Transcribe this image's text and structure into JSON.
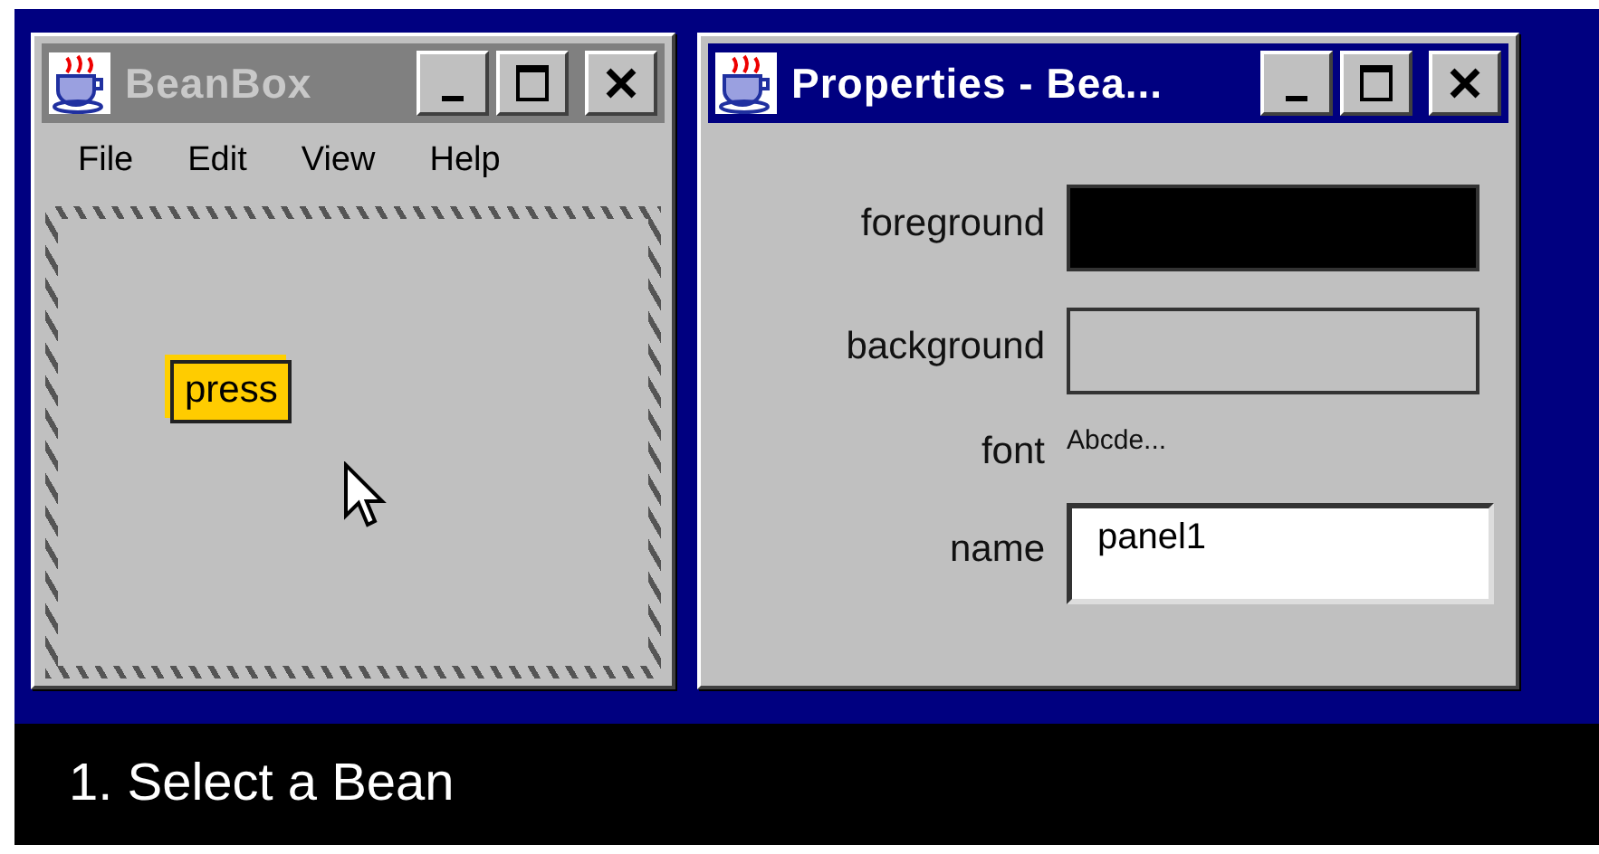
{
  "beanbox_window": {
    "title": "BeanBox",
    "active": false,
    "menu": [
      "File",
      "Edit",
      "View",
      "Help"
    ],
    "bean": {
      "label": "press",
      "selected": true
    }
  },
  "properties_window": {
    "title": "Properties - Bea...",
    "active": true,
    "properties": [
      {
        "kind": "color",
        "label": "foreground",
        "color": "#000000"
      },
      {
        "kind": "color",
        "label": "background",
        "color": "#c0c0c0"
      },
      {
        "kind": "font",
        "label": "font",
        "value": "Abcde..."
      },
      {
        "kind": "text",
        "label": "name",
        "value": "panel1"
      }
    ]
  },
  "caption": "1. Select a Bean"
}
